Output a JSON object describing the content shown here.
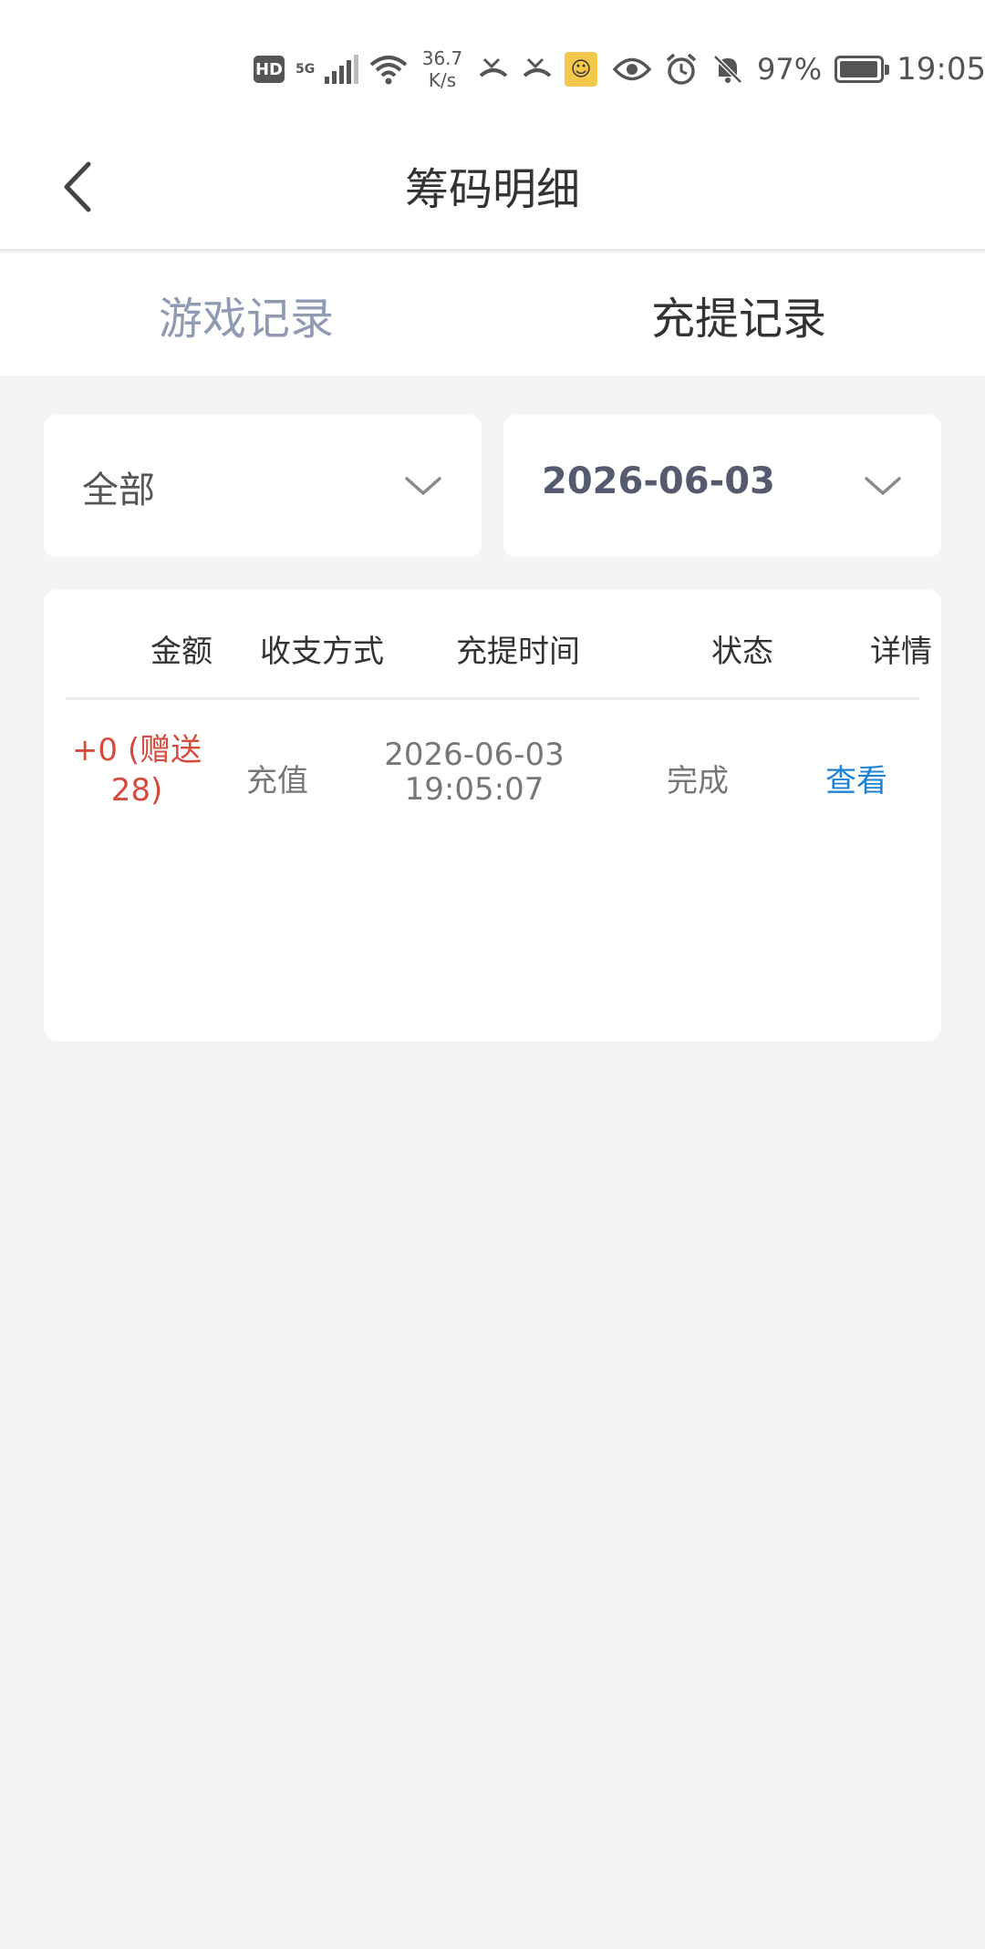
{
  "status_bar": {
    "hd": "HD",
    "network": "5G",
    "speed_value": "36.7",
    "speed_unit": "K/s",
    "battery": "97%",
    "battery_level": 0.97,
    "time": "19:05"
  },
  "header": {
    "title": "筹码明细"
  },
  "tabs": [
    {
      "label": "游戏记录",
      "active": false
    },
    {
      "label": "充提记录",
      "active": true
    }
  ],
  "filters": {
    "type": "全部",
    "date": "2026-06-03"
  },
  "table": {
    "columns": [
      "金额",
      "收支方式",
      "充提时间",
      "状态",
      "详情"
    ],
    "rows": [
      {
        "amount_line1": "+0 (赠送",
        "amount_line2": "28)",
        "type": "充值",
        "date": "2026-06-03",
        "time": "19:05:07",
        "status": "完成",
        "detail": "查看"
      }
    ]
  },
  "colors": {
    "amount": "#d54b3d",
    "link": "#1e83d4",
    "inactive_tab": "#8f9bb3",
    "background": "#f4f4f4"
  }
}
